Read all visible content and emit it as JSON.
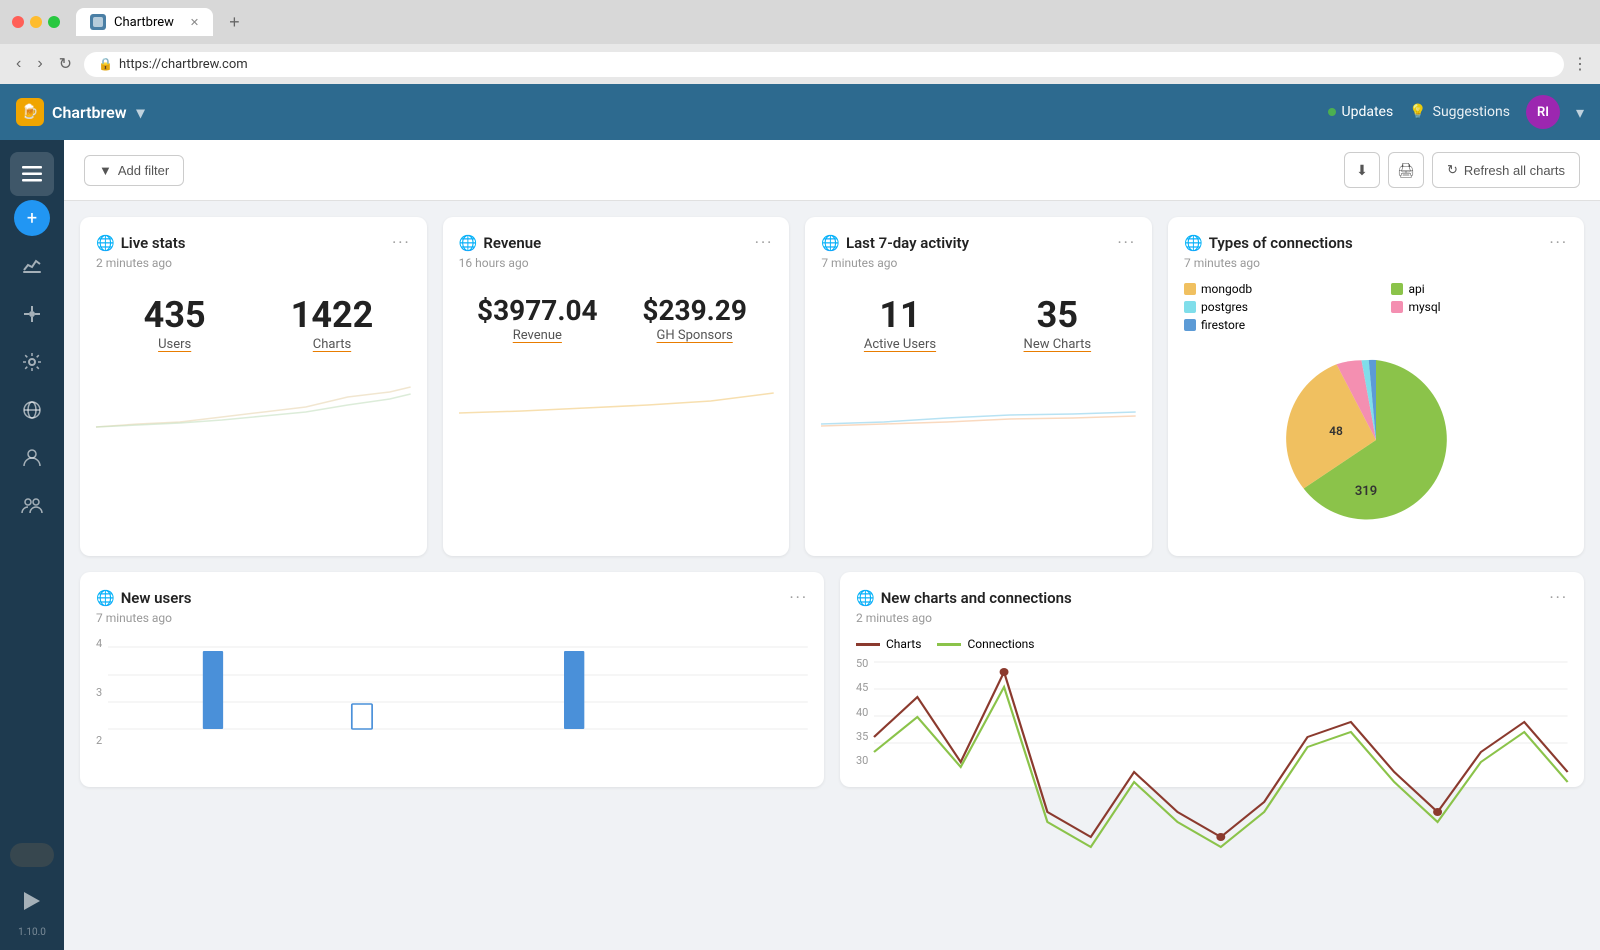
{
  "browser": {
    "url": "https://chartbrew.com",
    "tab_title": "Chartbrew",
    "new_tab_label": "+"
  },
  "topnav": {
    "brand": "Chartbrew",
    "updates_label": "Updates",
    "suggestions_label": "Suggestions",
    "avatar_initials": "RI"
  },
  "toolbar": {
    "filter_label": "Add filter",
    "refresh_label": "Refresh all charts"
  },
  "sidebar": {
    "version": "1.10.0"
  },
  "cards": {
    "live_stats": {
      "title": "Live stats",
      "time": "2 minutes ago",
      "kpi1_value": "435",
      "kpi1_label": "Users",
      "kpi2_value": "1422",
      "kpi2_label": "Charts"
    },
    "revenue": {
      "title": "Revenue",
      "time": "16 hours ago",
      "kpi1_value": "$3977.04",
      "kpi1_label": "Revenue",
      "kpi2_value": "$239.29",
      "kpi2_label": "GH Sponsors"
    },
    "activity": {
      "title": "Last 7-day activity",
      "time": "7 minutes ago",
      "kpi1_value": "11",
      "kpi1_label": "Active Users",
      "kpi2_value": "35",
      "kpi2_label": "New Charts"
    },
    "connections": {
      "title": "Types of connections",
      "time": "7 minutes ago",
      "legend": [
        {
          "label": "mongodb",
          "color": "#f0c060"
        },
        {
          "label": "api",
          "color": "#8bc34a"
        },
        {
          "label": "postgres",
          "color": "#80deea"
        },
        {
          "label": "mysql",
          "color": "#f48fb1"
        },
        {
          "label": "firestore",
          "color": "#5c9bd6"
        }
      ],
      "pie_data": [
        {
          "label": "api",
          "value": 319,
          "color": "#8bc34a",
          "percent": 84
        },
        {
          "label": "mongodb",
          "value": 48,
          "color": "#f0c060",
          "percent": 13
        },
        {
          "label": "mysql",
          "value": 8,
          "color": "#f48fb1",
          "percent": 2
        },
        {
          "label": "postgres",
          "value": 5,
          "color": "#80deea",
          "percent": 1
        },
        {
          "label": "firestore",
          "value": 3,
          "color": "#5c9bd6",
          "percent": 1
        }
      ]
    },
    "new_users": {
      "title": "New users",
      "time": "7 minutes ago",
      "y_axis": [
        "4",
        "3",
        "2"
      ],
      "bars": [
        0,
        0,
        0,
        3.8,
        0,
        0,
        0,
        0,
        1.2,
        0,
        0,
        0,
        0,
        0,
        0,
        3.8,
        0,
        0,
        0,
        0,
        0,
        0
      ]
    },
    "new_charts": {
      "title": "New charts and connections",
      "time": "2 minutes ago",
      "legend": [
        {
          "label": "Charts",
          "color": "#8b3a2e"
        },
        {
          "label": "Connections",
          "color": "#8bc34a"
        }
      ],
      "y_axis": [
        "50",
        "45",
        "40",
        "35",
        "30"
      ],
      "chart_values": [
        35,
        43,
        30,
        48,
        20,
        15,
        28,
        20,
        15,
        22,
        35,
        38,
        28,
        20,
        32,
        38,
        28
      ]
    }
  }
}
